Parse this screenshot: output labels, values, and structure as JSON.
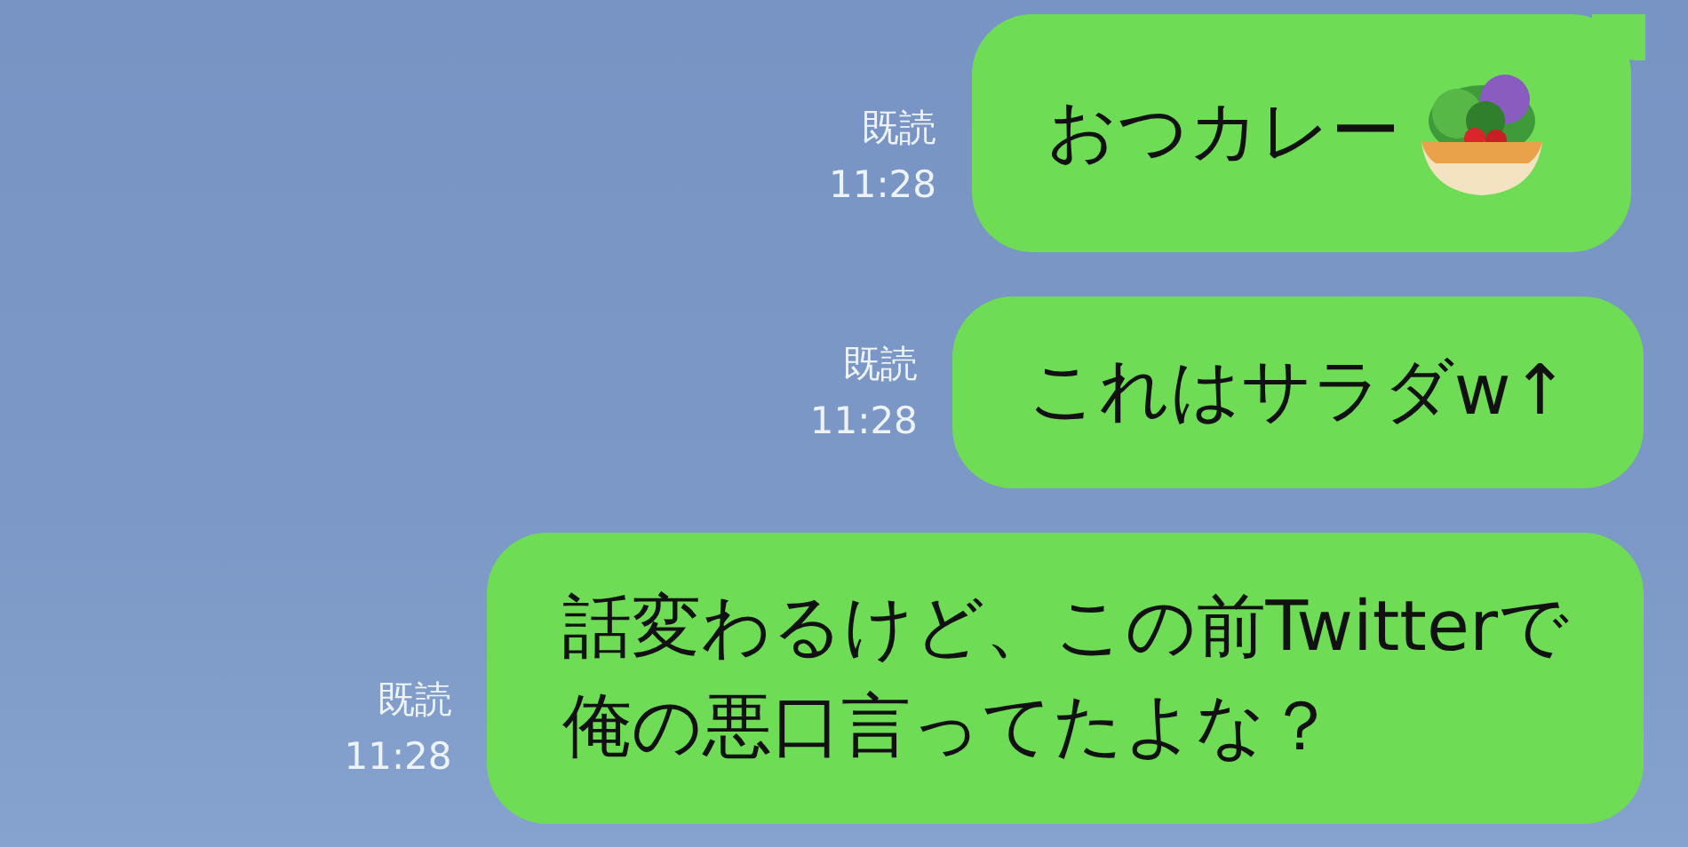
{
  "messages": [
    {
      "lines": [
        "おつカレー"
      ],
      "read": "既読",
      "time": "11:28",
      "tail": true,
      "trailing_icon": true
    },
    {
      "lines": [
        "これはサラダw↑"
      ],
      "read": "既読",
      "time": "11:28",
      "tail": false,
      "trailing_icon": false
    },
    {
      "lines": [
        "話変わるけど、この前Twitterで",
        "俺の悪口言ってたよな？"
      ],
      "read": "既読",
      "time": "11:28",
      "tail": false,
      "trailing_icon": false
    }
  ]
}
